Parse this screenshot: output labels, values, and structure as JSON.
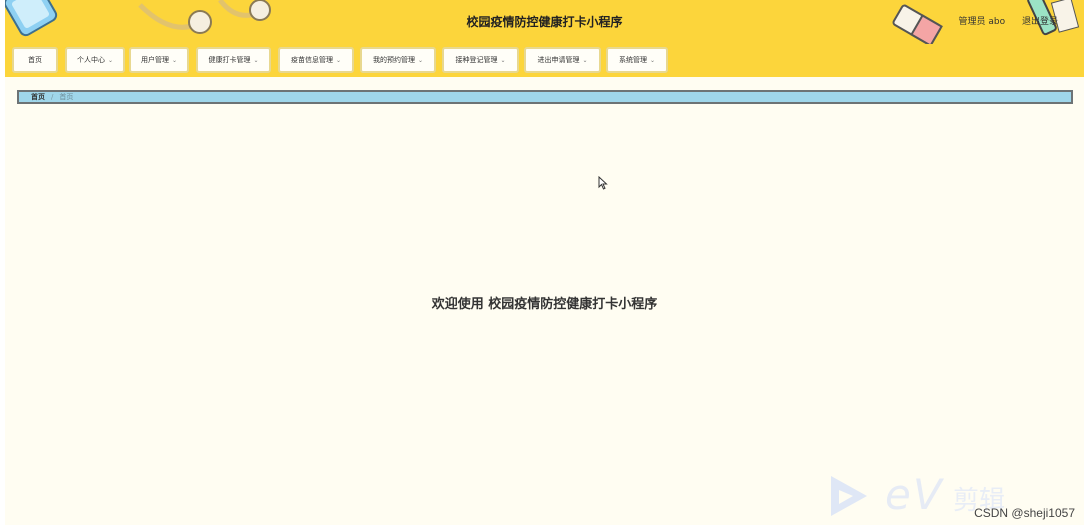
{
  "header": {
    "title": "校园疫情防控健康打卡小程序",
    "user_label": "管理员 abo",
    "logout_label": "退出登录"
  },
  "nav": {
    "items": [
      {
        "label": "首页",
        "has_dropdown": false
      },
      {
        "label": "个人中心",
        "has_dropdown": true
      },
      {
        "label": "用户管理",
        "has_dropdown": true
      },
      {
        "label": "健康打卡管理",
        "has_dropdown": true
      },
      {
        "label": "疫苗信息管理",
        "has_dropdown": true
      },
      {
        "label": "我的预约管理",
        "has_dropdown": true
      },
      {
        "label": "接种登记管理",
        "has_dropdown": true
      },
      {
        "label": "进出申请管理",
        "has_dropdown": true
      },
      {
        "label": "系统管理",
        "has_dropdown": true
      }
    ]
  },
  "breadcrumb": {
    "root": "首页",
    "current": "首页"
  },
  "main": {
    "welcome": "欢迎使用 校园疫情防控健康打卡小程序"
  },
  "watermark": {
    "ev_text": "eV",
    "ev_cn": "剪辑",
    "credit": "CSDN @sheji1057"
  },
  "colors": {
    "header_bg": "#fcd53b",
    "page_bg": "#fffdf2",
    "breadcrumb_bg": "#9fd6ea"
  }
}
